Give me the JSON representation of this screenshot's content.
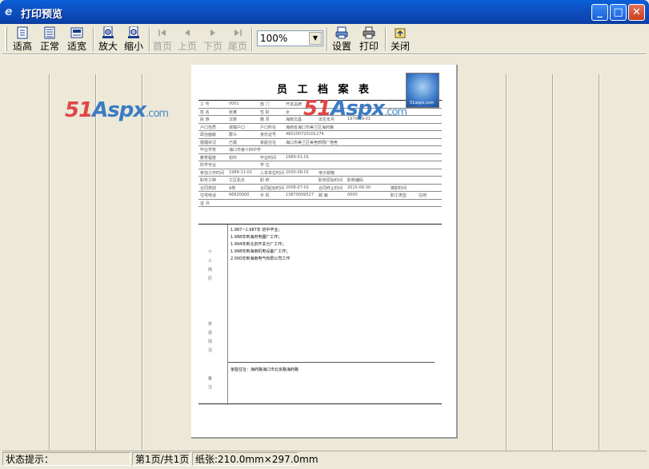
{
  "window": {
    "title": "打印预览",
    "minimize": "_",
    "maximize": "□",
    "close": "✕"
  },
  "toolbar": {
    "fit_height": "适高",
    "normal": "正常",
    "fit_width": "适宽",
    "zoom_in": "放大",
    "zoom_out": "缩小",
    "first_page": "首页",
    "prev_page": "上页",
    "next_page": "下页",
    "last_page": "尾页",
    "zoom_value": "100%",
    "settings": "设置",
    "print": "打印",
    "close": "关闭"
  },
  "document": {
    "title": "员 工 档 案 表",
    "rows": [
      [
        "工 号",
        "0001",
        "部 门",
        "开发品牌"
      ],
      [
        "姓 名",
        "张某",
        "性 别",
        "女"
      ],
      [
        "民 族",
        "汉族",
        "籍 贯",
        "海南文昌",
        "出生年月",
        "1970-09-01"
      ],
      [
        "户口性质",
        "城镇户口",
        "户口所在",
        "海南省海口市美兰区海府路"
      ],
      [
        "政治面貌",
        "群众",
        "身份证号",
        "460100720101274"
      ],
      [
        "婚姻状况",
        "已婚",
        "家庭住址",
        "海口市美兰区美舍鹤翔厂宿舍"
      ],
      [
        "毕业学校",
        "海口市第十四中学"
      ],
      [
        "教育程度",
        "初中",
        "毕业时间",
        "1989-01-01"
      ],
      [
        "所学专业",
        "",
        "学 位"
      ],
      [
        "参加工作时间",
        "1989-11-01",
        "入本单位时间",
        "2000-08-01",
        "电子邮箱"
      ],
      [
        "职务工种",
        "工区机长",
        "职 称",
        "",
        "职务原始时间",
        "职称编码"
      ],
      [
        "合同类别",
        "A类",
        "合同起始时间",
        "2008-07-01",
        "合同终止时间",
        "2015-06-30",
        "离职时间"
      ],
      [
        "住宅电话",
        "66620000",
        "手 机",
        "13870009527",
        "邮 编",
        "0000",
        "职工类型",
        "在岗"
      ],
      [
        "证 书"
      ]
    ],
    "label_resume": "个人简历",
    "label_reward": "奖惩情况",
    "label_remark": "备注",
    "resume": [
      "1.987~1.987年 初中毕业；",
      "1.988年到海府电器厂工作；",
      "1.994年到北京开关分厂工作；",
      "1.998年到海南机电设备厂工作；",
      "2.000年到海南电气有限公司工作"
    ],
    "note": "家庭住址：海府路海口市北京路海府路"
  },
  "watermark": {
    "prefix": "51",
    "mid": "Aspx",
    "suffix": ".com"
  },
  "logo_text": "51aspx.com",
  "status": {
    "hint": "状态提示：",
    "page": "第1页/共1页",
    "paper": "纸张:210.0mm×297.0mm"
  }
}
